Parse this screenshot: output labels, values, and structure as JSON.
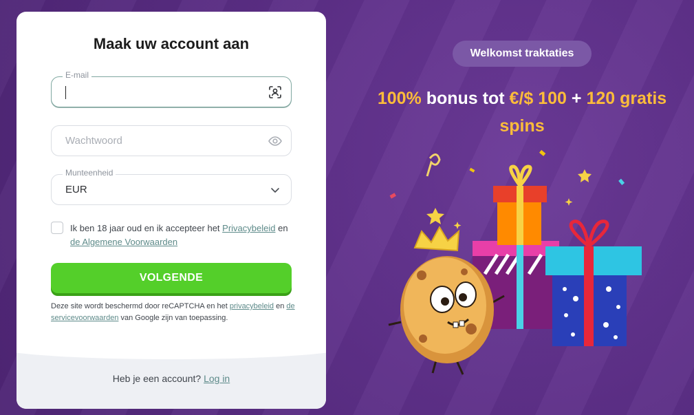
{
  "form": {
    "title": "Maak uw account aan",
    "email": {
      "label": "E-mail",
      "value": ""
    },
    "password": {
      "placeholder": "Wachtwoord"
    },
    "currency": {
      "label": "Munteenheid",
      "value": "EUR"
    },
    "consent": {
      "text_before": "Ik ben 18 jaar oud en ik accepteer het ",
      "privacy_link": "Privacybeleid",
      "text_middle": " en ",
      "terms_link": "de Algemene Voorwaarden"
    },
    "submit_label": "VOLGENDE",
    "recaptcha": {
      "text_before": "Deze site wordt beschermd door reCAPTCHA en het ",
      "privacy_link": "privacybeleid",
      "text_middle": " en ",
      "terms_link": "de servicevoorwaarden",
      "text_after": " van Google zijn van toepassing."
    },
    "login_prompt": "Heb je een account?",
    "login_link": "Log in"
  },
  "promo": {
    "pill_label": "Welkomst traktaties",
    "headline_part1": "100%",
    "headline_part2": " bonus tot ",
    "headline_part3": "€/$ 100",
    "headline_part4": " + ",
    "headline_part5": "120 gratis spins"
  },
  "icons": {
    "email_field": "face-scan-icon",
    "password_field": "eye-icon",
    "currency_field": "chevron-down-icon"
  },
  "colors": {
    "background": "#5c2f86",
    "button": "#54cf2a",
    "promo_accent": "#fcbc3a",
    "link": "#5d8a89"
  }
}
